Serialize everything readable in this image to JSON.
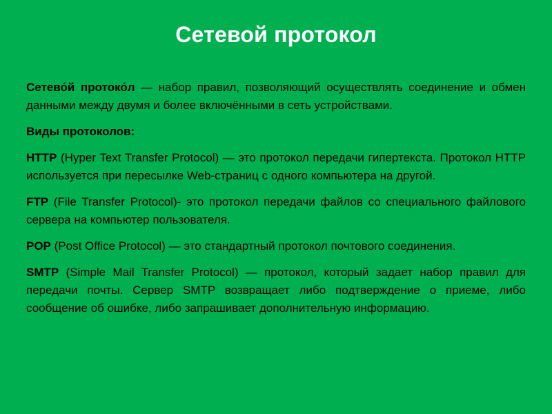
{
  "slide": {
    "title": "Сетевой протокол",
    "background_color": "#00B050",
    "title_color": "#FFFFFF",
    "body_color": "#000000",
    "paragraphs": [
      {
        "id": "definition",
        "label": "Сетево́й протоко́л",
        "text": " — набор правил, позволяющий осуществлять соединение и обмен данными между двумя и более включёнными в сеть устройствами."
      },
      {
        "id": "types-heading",
        "label": "Виды протоколов:",
        "text": ""
      },
      {
        "id": "http",
        "label": "HTTP",
        "text": " (Hyper Text Transfer Protocol) — это протокол передачи гипертекста. Протокол HTTP используется при пересылке Web-страниц с одного компьютера на другой."
      },
      {
        "id": "ftp",
        "label": "FTP",
        "text": " (File Transfer Protocol)- это протокол передачи файлов со специального файлового сервера на компьютер пользователя."
      },
      {
        "id": "pop",
        "label": "POP",
        "text": " (Post Office Protocol) — это стандартный протокол почтового соединения."
      },
      {
        "id": "smtp",
        "label": "SMTP",
        "text": " (Simple Mail Transfer Protocol) — протокол, который задает набор правил для передачи почты. Сервер SMTP возвращает либо подтверждение о приеме, либо сообщение об ошибке, либо запрашивает дополнительную информацию."
      }
    ]
  }
}
